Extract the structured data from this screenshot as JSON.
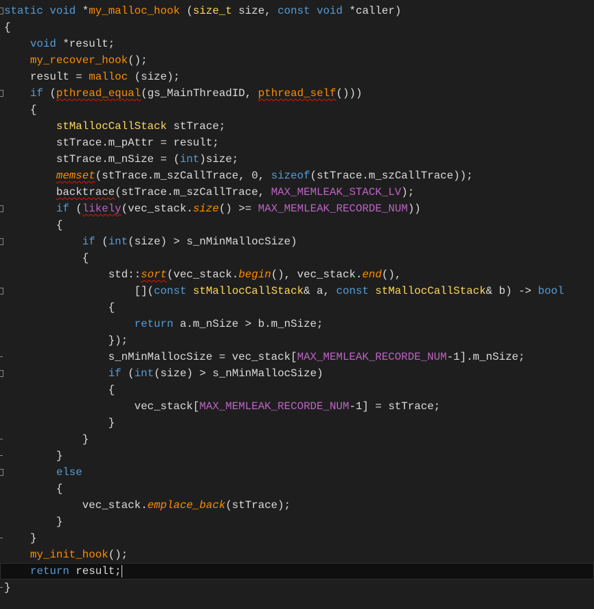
{
  "editor": {
    "theme": "dark",
    "colors": {
      "background": "#1e1e1e",
      "keyword": "#569cd6",
      "function": "#ff8c00",
      "class": "#ffd75f",
      "macro": "#bd63c5",
      "text": "#dcdcdc",
      "error_squiggle": "#e51400"
    },
    "current_line_index": 34,
    "lines": [
      {
        "fold": "box",
        "tokens": [
          {
            "t": "static ",
            "c": "kw"
          },
          {
            "t": "void ",
            "c": "kw"
          },
          {
            "t": "*",
            "c": "plain"
          },
          {
            "t": "my_malloc_hook",
            "c": "fn"
          },
          {
            "t": " (",
            "c": "plain"
          },
          {
            "t": "size_t",
            "c": "cls"
          },
          {
            "t": " size, ",
            "c": "plain"
          },
          {
            "t": "const ",
            "c": "kw"
          },
          {
            "t": "void ",
            "c": "kw"
          },
          {
            "t": "*caller)",
            "c": "plain"
          }
        ]
      },
      {
        "fold": "",
        "tokens": [
          {
            "t": "{",
            "c": "plain"
          }
        ]
      },
      {
        "fold": "",
        "tokens": [
          {
            "t": "    ",
            "c": "plain"
          },
          {
            "t": "void ",
            "c": "kw"
          },
          {
            "t": "*result;",
            "c": "plain"
          }
        ]
      },
      {
        "fold": "",
        "tokens": [
          {
            "t": "    ",
            "c": "plain"
          },
          {
            "t": "my_recover_hook",
            "c": "fn"
          },
          {
            "t": "();",
            "c": "plain"
          }
        ]
      },
      {
        "fold": "",
        "tokens": [
          {
            "t": "    result = ",
            "c": "plain"
          },
          {
            "t": "malloc",
            "c": "fn"
          },
          {
            "t": " (size);",
            "c": "plain"
          }
        ]
      },
      {
        "fold": "box",
        "tokens": [
          {
            "t": "    ",
            "c": "plain"
          },
          {
            "t": "if",
            "c": "kw"
          },
          {
            "t": " (",
            "c": "plain"
          },
          {
            "t": "pthread_equal",
            "c": "fn",
            "sq": true
          },
          {
            "t": "(gs_MainThreadID, ",
            "c": "plain"
          },
          {
            "t": "pthread_self",
            "c": "fn",
            "sq": true
          },
          {
            "t": "()))",
            "c": "plain"
          }
        ]
      },
      {
        "fold": "",
        "tokens": [
          {
            "t": "    {",
            "c": "plain"
          }
        ]
      },
      {
        "fold": "",
        "tokens": [
          {
            "t": "        ",
            "c": "plain"
          },
          {
            "t": "stMallocCallStack",
            "c": "cls"
          },
          {
            "t": " stTrace;",
            "c": "plain"
          }
        ]
      },
      {
        "fold": "",
        "tokens": [
          {
            "t": "        stTrace.m_pAttr = result;",
            "c": "plain"
          }
        ]
      },
      {
        "fold": "",
        "tokens": [
          {
            "t": "        stTrace.m_nSize = (",
            "c": "plain"
          },
          {
            "t": "int",
            "c": "kw"
          },
          {
            "t": ")size;",
            "c": "plain"
          }
        ]
      },
      {
        "fold": "",
        "tokens": [
          {
            "t": "        ",
            "c": "plain"
          },
          {
            "t": "memset",
            "c": "fni",
            "sq": true
          },
          {
            "t": "(stTrace.m_szCallTrace, ",
            "c": "plain"
          },
          {
            "t": "0",
            "c": "plain"
          },
          {
            "t": ", ",
            "c": "plain"
          },
          {
            "t": "sizeof",
            "c": "kw"
          },
          {
            "t": "(stTrace.m_szCallTrace));",
            "c": "plain"
          }
        ]
      },
      {
        "fold": "",
        "tokens": [
          {
            "t": "        ",
            "c": "plain"
          },
          {
            "t": "backtrace",
            "c": "plain",
            "sq": true
          },
          {
            "t": "(stTrace.m_szCallTrace, ",
            "c": "plain"
          },
          {
            "t": "MAX_MEMLEAK_STACK_LV",
            "c": "macro"
          },
          {
            "t": ");",
            "c": "plain"
          }
        ]
      },
      {
        "fold": "box",
        "tokens": [
          {
            "t": "        ",
            "c": "plain"
          },
          {
            "t": "if",
            "c": "kw"
          },
          {
            "t": " (",
            "c": "plain"
          },
          {
            "t": "likely",
            "c": "macro",
            "sq": true
          },
          {
            "t": "(vec_stack.",
            "c": "plain"
          },
          {
            "t": "size",
            "c": "meth"
          },
          {
            "t": "() >= ",
            "c": "plain"
          },
          {
            "t": "MAX_MEMLEAK_RECORDE_NUM",
            "c": "macro"
          },
          {
            "t": "))",
            "c": "plain"
          }
        ]
      },
      {
        "fold": "",
        "tokens": [
          {
            "t": "        {",
            "c": "plain"
          }
        ]
      },
      {
        "fold": "box",
        "tokens": [
          {
            "t": "            ",
            "c": "plain"
          },
          {
            "t": "if",
            "c": "kw"
          },
          {
            "t": " (",
            "c": "plain"
          },
          {
            "t": "int",
            "c": "kw"
          },
          {
            "t": "(size) > s_nMinMallocSize)",
            "c": "plain"
          }
        ]
      },
      {
        "fold": "",
        "tokens": [
          {
            "t": "            {",
            "c": "plain"
          }
        ]
      },
      {
        "fold": "",
        "tokens": [
          {
            "t": "                ",
            "c": "plain"
          },
          {
            "t": "std",
            "c": "ns"
          },
          {
            "t": "::",
            "c": "plain"
          },
          {
            "t": "sort",
            "c": "fni",
            "sq": true
          },
          {
            "t": "(vec_stack.",
            "c": "plain"
          },
          {
            "t": "begin",
            "c": "meth"
          },
          {
            "t": "(), vec_stack.",
            "c": "plain"
          },
          {
            "t": "end",
            "c": "meth"
          },
          {
            "t": "(),",
            "c": "plain"
          }
        ]
      },
      {
        "fold": "box",
        "tokens": [
          {
            "t": "                    [](",
            "c": "plain"
          },
          {
            "t": "const ",
            "c": "kw"
          },
          {
            "t": "stMallocCallStack",
            "c": "cls"
          },
          {
            "t": "& a, ",
            "c": "plain"
          },
          {
            "t": "const ",
            "c": "kw"
          },
          {
            "t": "stMallocCallStack",
            "c": "cls"
          },
          {
            "t": "& b) -> ",
            "c": "plain"
          },
          {
            "t": "bool",
            "c": "kw"
          }
        ]
      },
      {
        "fold": "",
        "tokens": [
          {
            "t": "                {",
            "c": "plain"
          }
        ]
      },
      {
        "fold": "",
        "tokens": [
          {
            "t": "                    ",
            "c": "plain"
          },
          {
            "t": "return",
            "c": "kw"
          },
          {
            "t": " a.m_nSize > b.m_nSize;",
            "c": "plain"
          }
        ]
      },
      {
        "fold": "",
        "tokens": [
          {
            "t": "                });",
            "c": "plain"
          }
        ]
      },
      {
        "fold": "end",
        "tokens": [
          {
            "t": "                s_nMinMallocSize = vec_stack[",
            "c": "plain"
          },
          {
            "t": "MAX_MEMLEAK_RECORDE_NUM",
            "c": "macro"
          },
          {
            "t": "-1].m_nSize;",
            "c": "plain"
          }
        ]
      },
      {
        "fold": "box",
        "tokens": [
          {
            "t": "                ",
            "c": "plain"
          },
          {
            "t": "if",
            "c": "kw"
          },
          {
            "t": " (",
            "c": "plain"
          },
          {
            "t": "int",
            "c": "kw"
          },
          {
            "t": "(size) > s_nMinMallocSize)",
            "c": "plain"
          }
        ]
      },
      {
        "fold": "",
        "tokens": [
          {
            "t": "                {",
            "c": "plain"
          }
        ]
      },
      {
        "fold": "",
        "tokens": [
          {
            "t": "                    vec_stack[",
            "c": "plain"
          },
          {
            "t": "MAX_MEMLEAK_RECORDE_NUM",
            "c": "macro"
          },
          {
            "t": "-1] = stTrace;",
            "c": "plain"
          }
        ]
      },
      {
        "fold": "",
        "tokens": [
          {
            "t": "                }",
            "c": "plain"
          }
        ]
      },
      {
        "fold": "end",
        "tokens": [
          {
            "t": "            }",
            "c": "plain"
          }
        ]
      },
      {
        "fold": "end",
        "tokens": [
          {
            "t": "        }",
            "c": "plain"
          }
        ]
      },
      {
        "fold": "box",
        "tokens": [
          {
            "t": "        ",
            "c": "plain"
          },
          {
            "t": "else",
            "c": "kw"
          }
        ]
      },
      {
        "fold": "",
        "tokens": [
          {
            "t": "        {",
            "c": "plain"
          }
        ]
      },
      {
        "fold": "",
        "tokens": [
          {
            "t": "            vec_stack.",
            "c": "plain"
          },
          {
            "t": "emplace_back",
            "c": "meth"
          },
          {
            "t": "(stTrace);",
            "c": "plain"
          }
        ]
      },
      {
        "fold": "",
        "tokens": [
          {
            "t": "        }",
            "c": "plain"
          }
        ]
      },
      {
        "fold": "end",
        "tokens": [
          {
            "t": "    }",
            "c": "plain"
          }
        ]
      },
      {
        "fold": "",
        "tokens": [
          {
            "t": "    ",
            "c": "plain"
          },
          {
            "t": "my_init_hook",
            "c": "fn"
          },
          {
            "t": "();",
            "c": "plain"
          }
        ]
      },
      {
        "fold": "",
        "tokens": [
          {
            "t": "    ",
            "c": "plain"
          },
          {
            "t": "return",
            "c": "kw"
          },
          {
            "t": " result;",
            "c": "plain"
          }
        ]
      },
      {
        "fold": "end",
        "tokens": [
          {
            "t": "}",
            "c": "plain"
          }
        ]
      }
    ]
  }
}
